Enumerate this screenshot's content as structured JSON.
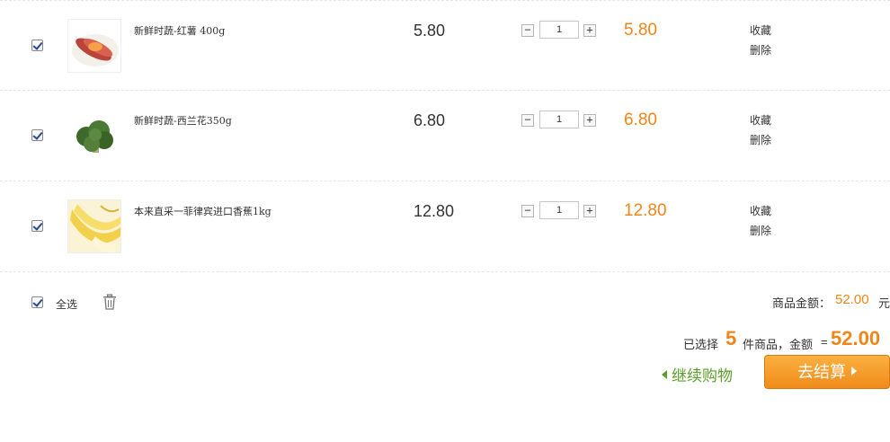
{
  "items": [
    {
      "name": "新鲜时蔬-红薯 400g",
      "price": "5.80",
      "quantity": "1",
      "subtotal": "5.80",
      "favorite_label": "收藏",
      "delete_label": "删除",
      "checked": true,
      "image_icon": "sweet-potato-image"
    },
    {
      "name": "新鲜时蔬-西兰花350g",
      "price": "6.80",
      "quantity": "1",
      "subtotal": "6.80",
      "favorite_label": "收藏",
      "delete_label": "删除",
      "checked": true,
      "image_icon": "broccoli-image"
    },
    {
      "name": "本来直采一菲律宾进口香蕉1kg",
      "price": "12.80",
      "quantity": "1",
      "subtotal": "12.80",
      "favorite_label": "收藏",
      "delete_label": "删除",
      "checked": true,
      "image_icon": "banana-image"
    }
  ],
  "qty_controls": {
    "minus": "−",
    "plus": "+"
  },
  "footer": {
    "select_all_label": "全选",
    "trash_icon": "trash-icon",
    "goods_total_label": "商品金额：",
    "goods_total_value": "52.00",
    "goods_total_unit": "元",
    "selected_prefix": "已选择",
    "selected_count": "5",
    "selected_suffix": "件商品，金额",
    "amount_eq": "=",
    "amount_value": "52.00",
    "continue_label": "继续购物",
    "checkout_label": "去结算"
  },
  "colors": {
    "accent_orange": "#f08519",
    "continue_green": "#5b9e2b",
    "checkout_top": "#fbb140",
    "checkout_bottom": "#f08a1a"
  }
}
